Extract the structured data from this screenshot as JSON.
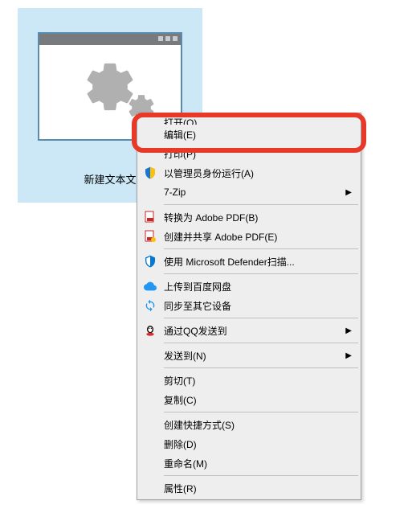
{
  "desktop": {
    "file_label": "新建文本文"
  },
  "menu": {
    "open": "打开(O)",
    "edit": "编辑(E)",
    "print": "打印(P)",
    "run_as_admin": "以管理员身份运行(A)",
    "seven_zip": "7-Zip",
    "convert_pdf": "转换为 Adobe PDF(B)",
    "create_share_pdf": "创建并共享 Adobe PDF(E)",
    "defender_scan": "使用 Microsoft Defender扫描...",
    "upload_baidu": "上传到百度网盘",
    "sync_devices": "同步至其它设备",
    "qq_send": "通过QQ发送到",
    "send_to": "发送到(N)",
    "cut": "剪切(T)",
    "copy": "复制(C)",
    "create_shortcut": "创建快捷方式(S)",
    "delete": "删除(D)",
    "rename": "重命名(M)",
    "properties": "属性(R)"
  }
}
